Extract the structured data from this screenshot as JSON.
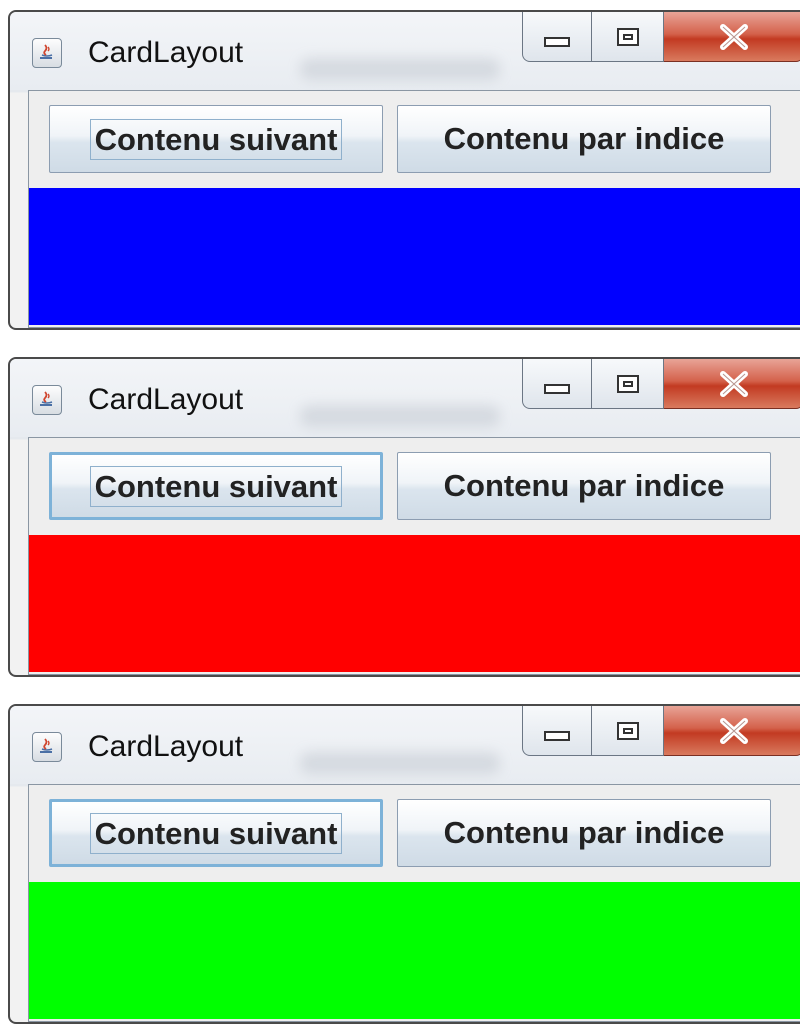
{
  "windows": [
    {
      "title": "CardLayout",
      "buttons": {
        "next": "Contenu suivant",
        "index": "Contenu par indice"
      },
      "card_color": "#0000ff",
      "next_focused": false
    },
    {
      "title": "CardLayout",
      "buttons": {
        "next": "Contenu suivant",
        "index": "Contenu par indice"
      },
      "card_color": "#ff0000",
      "next_focused": true
    },
    {
      "title": "CardLayout",
      "buttons": {
        "next": "Contenu suivant",
        "index": "Contenu par indice"
      },
      "card_color": "#00ff00",
      "next_focused": true
    }
  ],
  "icons": {
    "app": "java-cup-icon",
    "minimize": "minimize-icon",
    "maximize": "maximize-icon",
    "close": "close-icon"
  }
}
